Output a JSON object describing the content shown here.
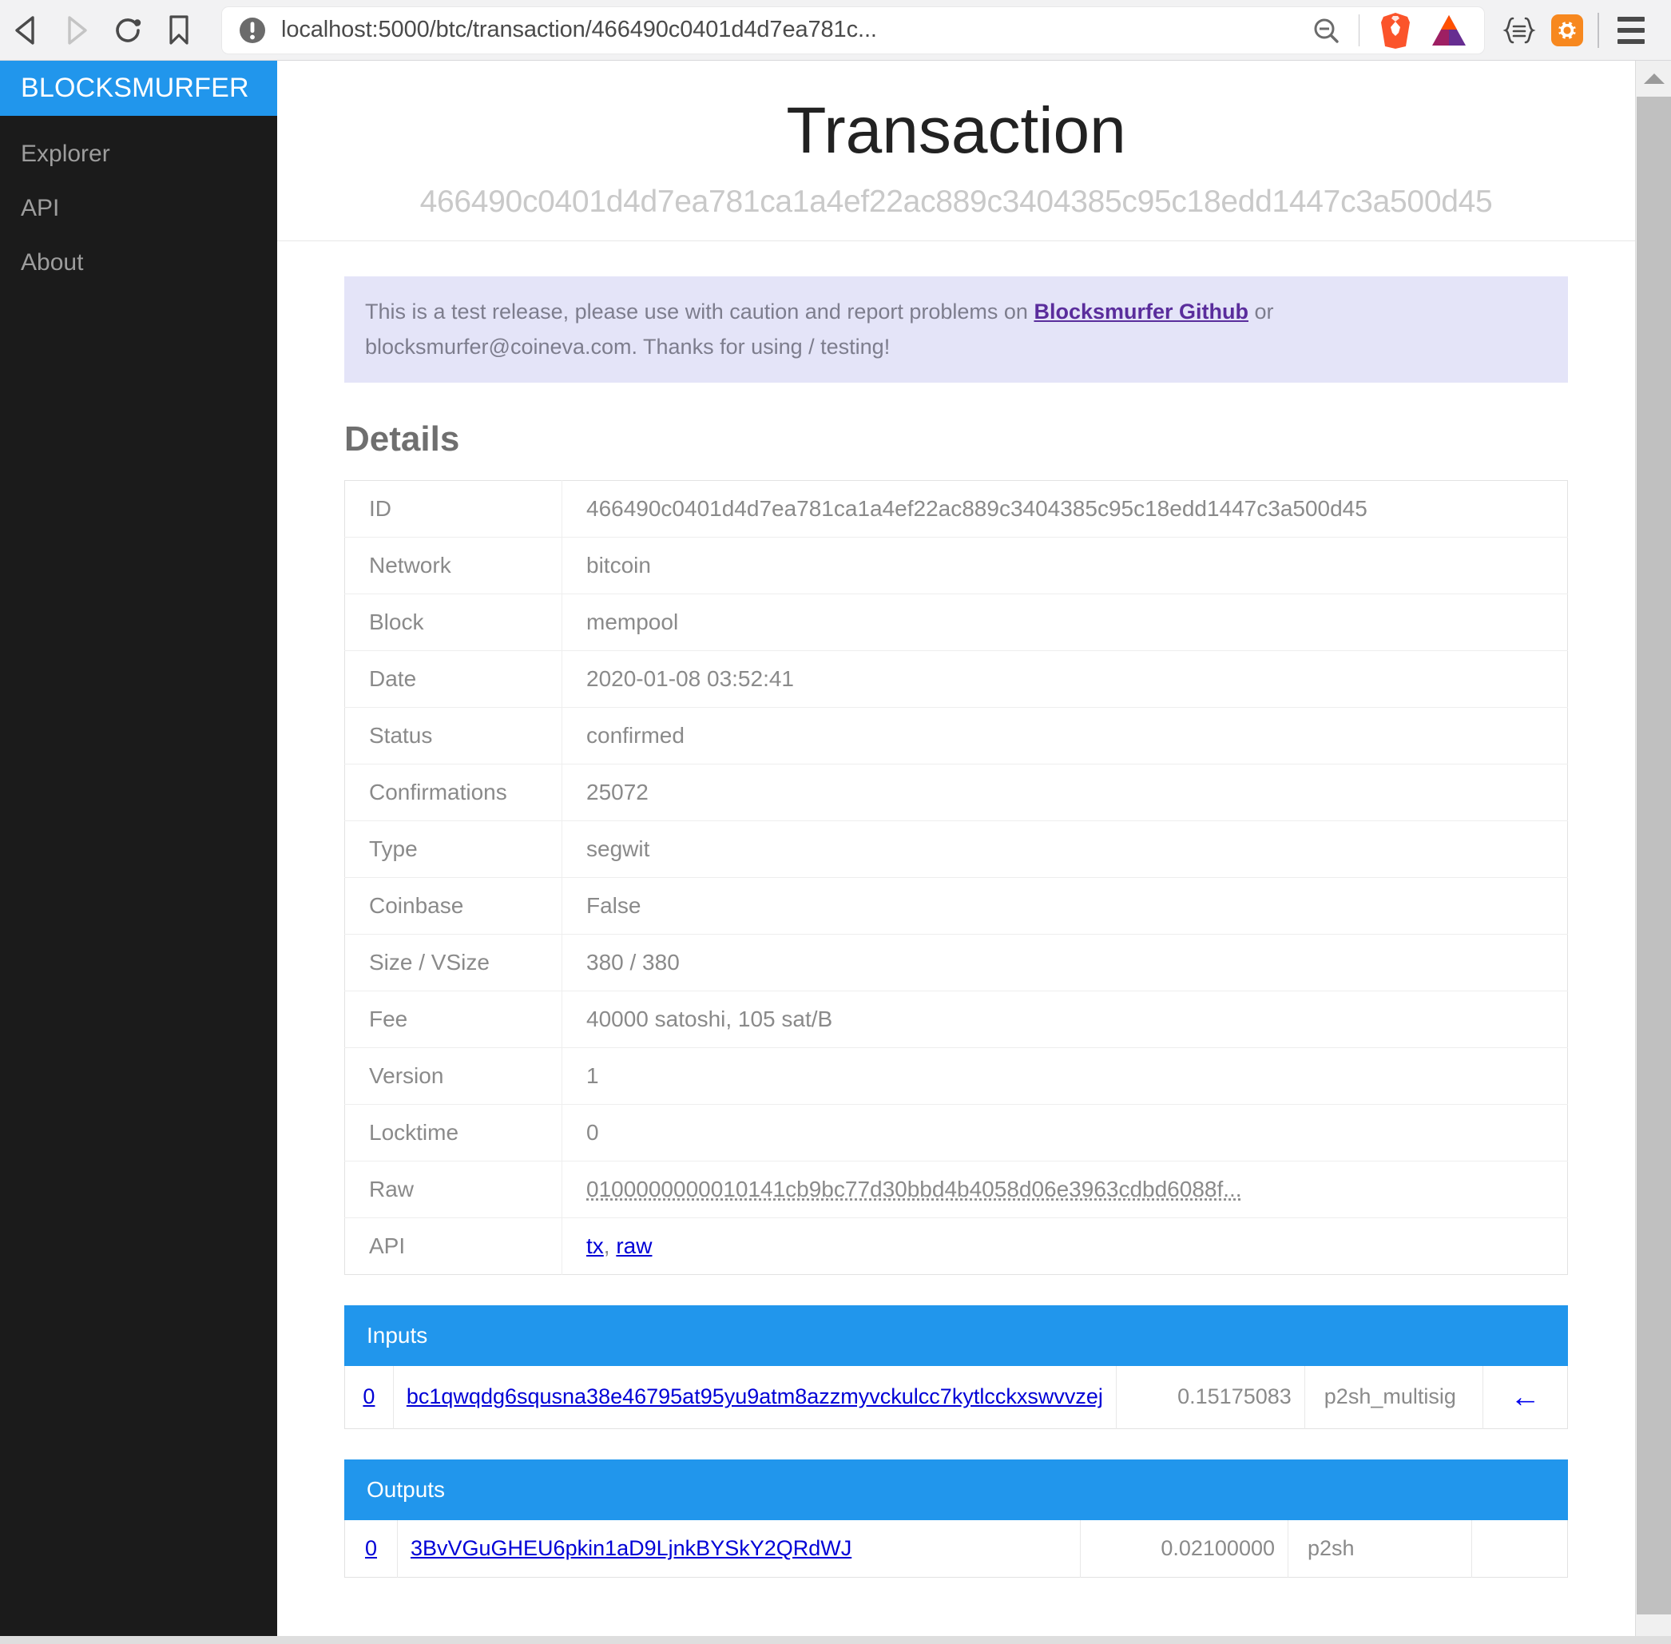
{
  "browser": {
    "back_label": "Back",
    "forward_label": "Forward",
    "reload_label": "Reload",
    "bookmark_label": "Bookmark",
    "url": "localhost:5000/btc/transaction/466490c0401d4d7ea781c...",
    "zoom_out_label": "Zoom out",
    "brave_label": "Brave Shields",
    "bat_label": "Brave Rewards",
    "ext_json_label": "{≡}",
    "ext_gear_label": "Extension settings",
    "menu_label": "Menu"
  },
  "sidebar": {
    "brand": "BLOCKSMURFER",
    "items": [
      {
        "label": "Explorer"
      },
      {
        "label": "API"
      },
      {
        "label": "About"
      }
    ]
  },
  "page": {
    "title": "Transaction",
    "subtitle": "466490c0401d4d7ea781ca1a4ef22ac889c3404385c95c18edd1447c3a500d45"
  },
  "alert": {
    "text_before": "This is a test release, please use with caution and report problems on ",
    "link_label": "Blocksmurfer Github",
    "text_after": " or blocksmurfer@coineva.com. Thanks for using / testing!"
  },
  "details": {
    "heading": "Details",
    "rows": [
      {
        "key": "ID",
        "value": "466490c0401d4d7ea781ca1a4ef22ac889c3404385c95c18edd1447c3a500d45"
      },
      {
        "key": "Network",
        "value": "bitcoin"
      },
      {
        "key": "Block",
        "value": "mempool"
      },
      {
        "key": "Date",
        "value": "2020-01-08 03:52:41"
      },
      {
        "key": "Status",
        "value": "confirmed"
      },
      {
        "key": "Confirmations",
        "value": "25072"
      },
      {
        "key": "Type",
        "value": "segwit"
      },
      {
        "key": "Coinbase",
        "value": "False"
      },
      {
        "key": "Size / VSize",
        "value": "380 / 380"
      },
      {
        "key": "Fee",
        "value": "40000 satoshi, 105 sat/B"
      },
      {
        "key": "Version",
        "value": "1"
      },
      {
        "key": "Locktime",
        "value": "0"
      }
    ],
    "raw_key": "Raw",
    "raw_value": "0100000000010141cb9bc77d30bbd4b4058d06e3963cdbd6088f...",
    "api_key": "API",
    "api_tx_label": "tx",
    "api_sep": ", ",
    "api_raw_label": "raw"
  },
  "inputs": {
    "heading": "Inputs",
    "rows": [
      {
        "index": "0",
        "address": "bc1qwqdg6squsna38e46795at95yu9atm8azzmyvckulcc7kytlcckxswvvzej",
        "amount": "0.15175083",
        "script_type": "p2sh_multisig",
        "direction_icon": "arrow-left-icon"
      }
    ]
  },
  "outputs": {
    "heading": "Outputs",
    "rows": [
      {
        "index": "0",
        "address": "3BvVGuGHEU6pkin1aD9LjnkBYSkY2QRdWJ",
        "amount": "0.02100000",
        "script_type": "p2sh"
      }
    ]
  },
  "colors": {
    "brand_blue": "#2196ec",
    "sidebar_dark": "#1b1b1b",
    "link_blue": "#0000d6",
    "alert_bg": "#e4e4f8"
  }
}
